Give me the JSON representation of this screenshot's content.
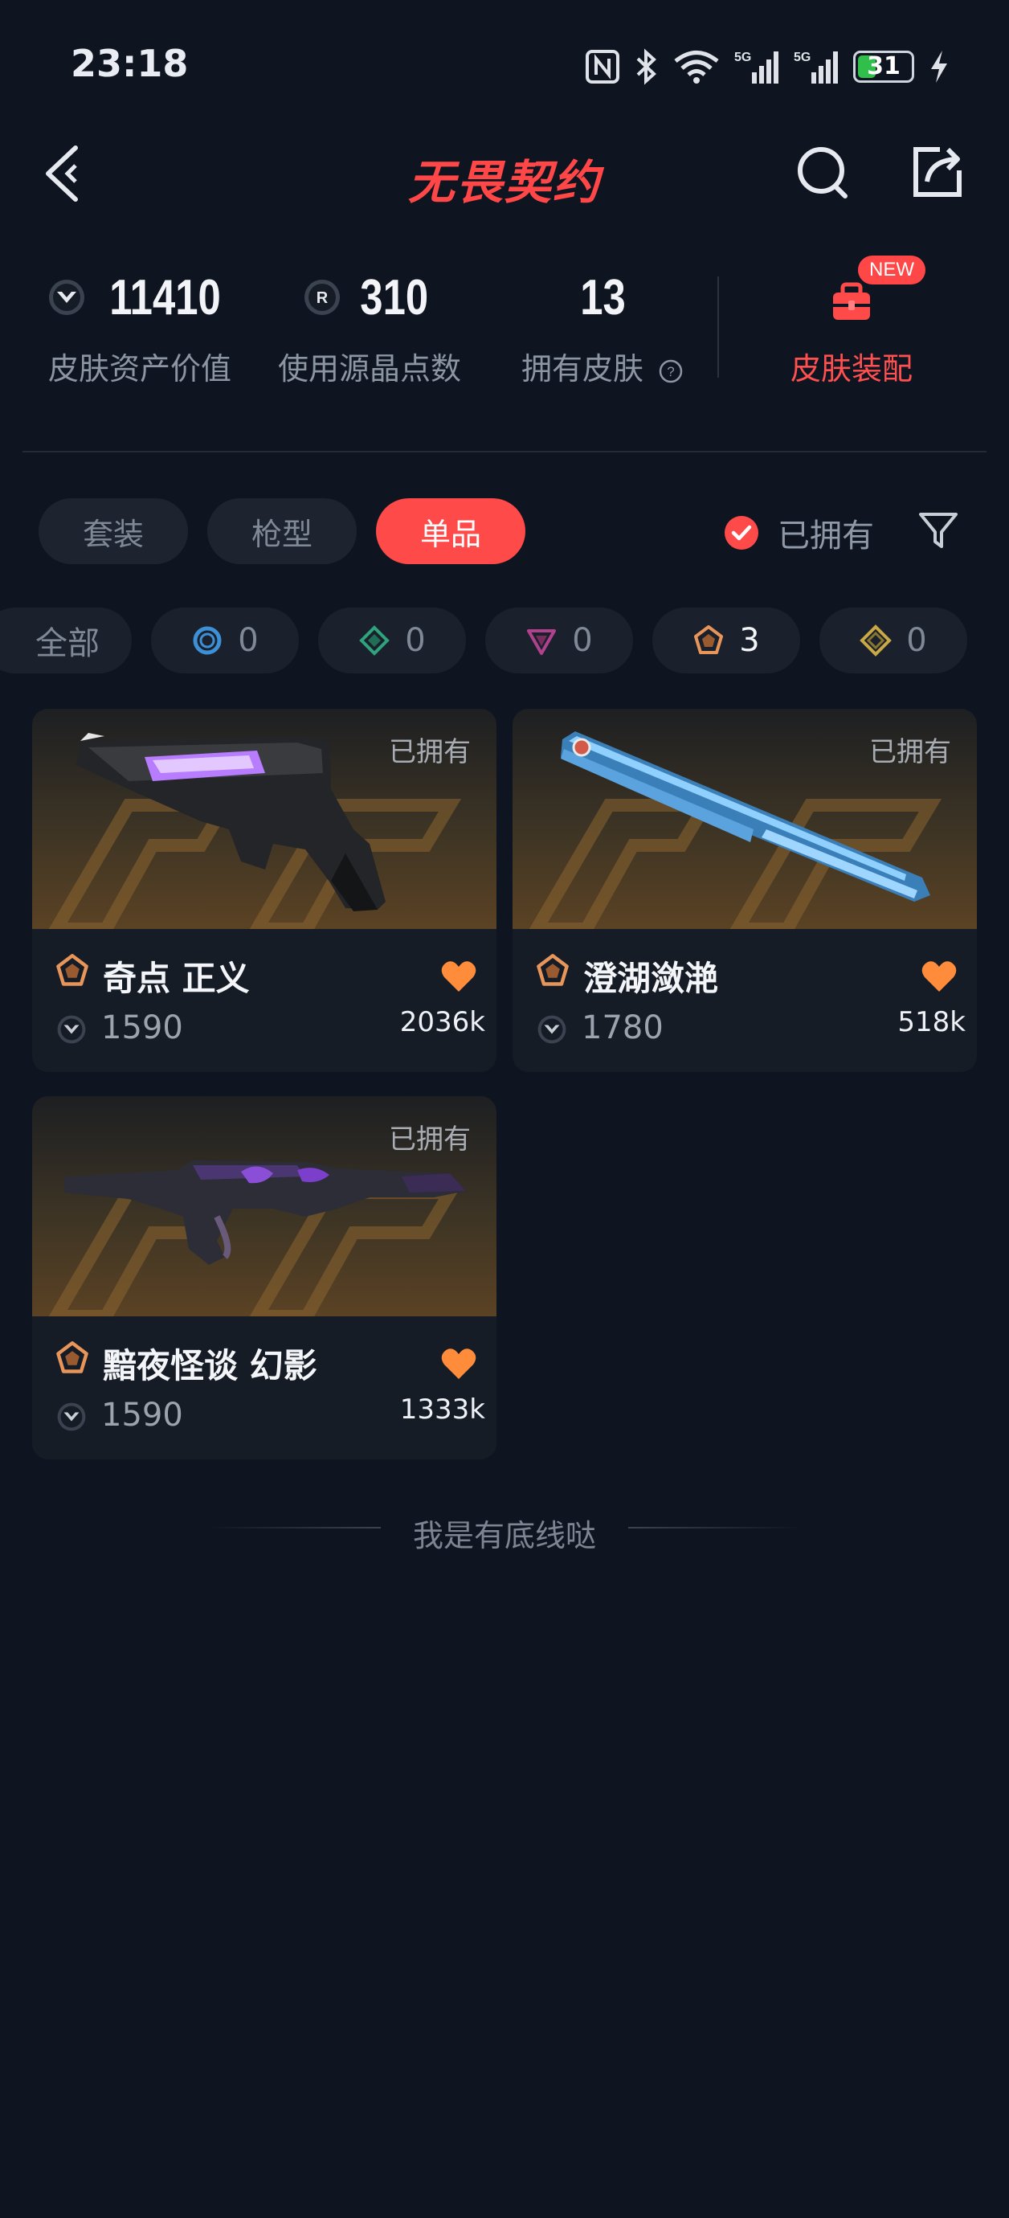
{
  "status_bar": {
    "time": "23:18",
    "battery": "31",
    "battery_level": 0.31,
    "signal_label_1": "5G",
    "signal_label_2": "5G",
    "icons": [
      "nfc-icon",
      "bluetooth-icon",
      "wifi-icon",
      "signal-5g-icon",
      "signal-5g-icon",
      "battery-icon",
      "charging-icon"
    ]
  },
  "header": {
    "title": "无畏契约",
    "icons": [
      "back-icon",
      "search-icon",
      "share-icon"
    ]
  },
  "stats": {
    "asset_value": "11410",
    "asset_value_label": "皮肤资产价值",
    "radianite": "310",
    "radianite_label": "使用源晶点数",
    "owned_count": "13",
    "owned_label": "拥有皮肤",
    "equip_label": "皮肤装配",
    "equip_badge": "NEW"
  },
  "tabs": [
    {
      "label": "套装",
      "active": false
    },
    {
      "label": "枪型",
      "active": false
    },
    {
      "label": "单品",
      "active": true
    }
  ],
  "owned_filter": {
    "label": "已拥有",
    "checked": true
  },
  "rarity_chips": [
    {
      "label": "全部"
    },
    {
      "count": "0",
      "icon": "select-tier-icon",
      "color": "#3d8fd6"
    },
    {
      "count": "0",
      "icon": "deluxe-tier-icon",
      "color": "#2fa37c"
    },
    {
      "count": "0",
      "icon": "premium-tier-icon",
      "color": "#b0418c"
    },
    {
      "count": "3",
      "icon": "exclusive-tier-icon",
      "color": "#e8955a"
    },
    {
      "count": "0",
      "icon": "ultra-tier-icon",
      "color": "#c9a945"
    }
  ],
  "skins": [
    {
      "name": "奇点 正义",
      "price": "1590",
      "likes": "2036k",
      "owned_tag": "已拥有",
      "rarity": "exclusive-tier-icon"
    },
    {
      "name": "澄湖潋滟",
      "price": "1780",
      "likes": "518k",
      "owned_tag": "已拥有",
      "rarity": "exclusive-tier-icon"
    },
    {
      "name": "黯夜怪谈 幻影",
      "price": "1590",
      "likes": "1333k",
      "owned_tag": "已拥有",
      "rarity": "exclusive-tier-icon"
    }
  ],
  "footer": {
    "text": "我是有底线哒"
  },
  "colors": {
    "accent": "#ff4a4a",
    "background": "#0f1520",
    "heart": "#ff8c3a",
    "exclusive": "#e8955a"
  }
}
